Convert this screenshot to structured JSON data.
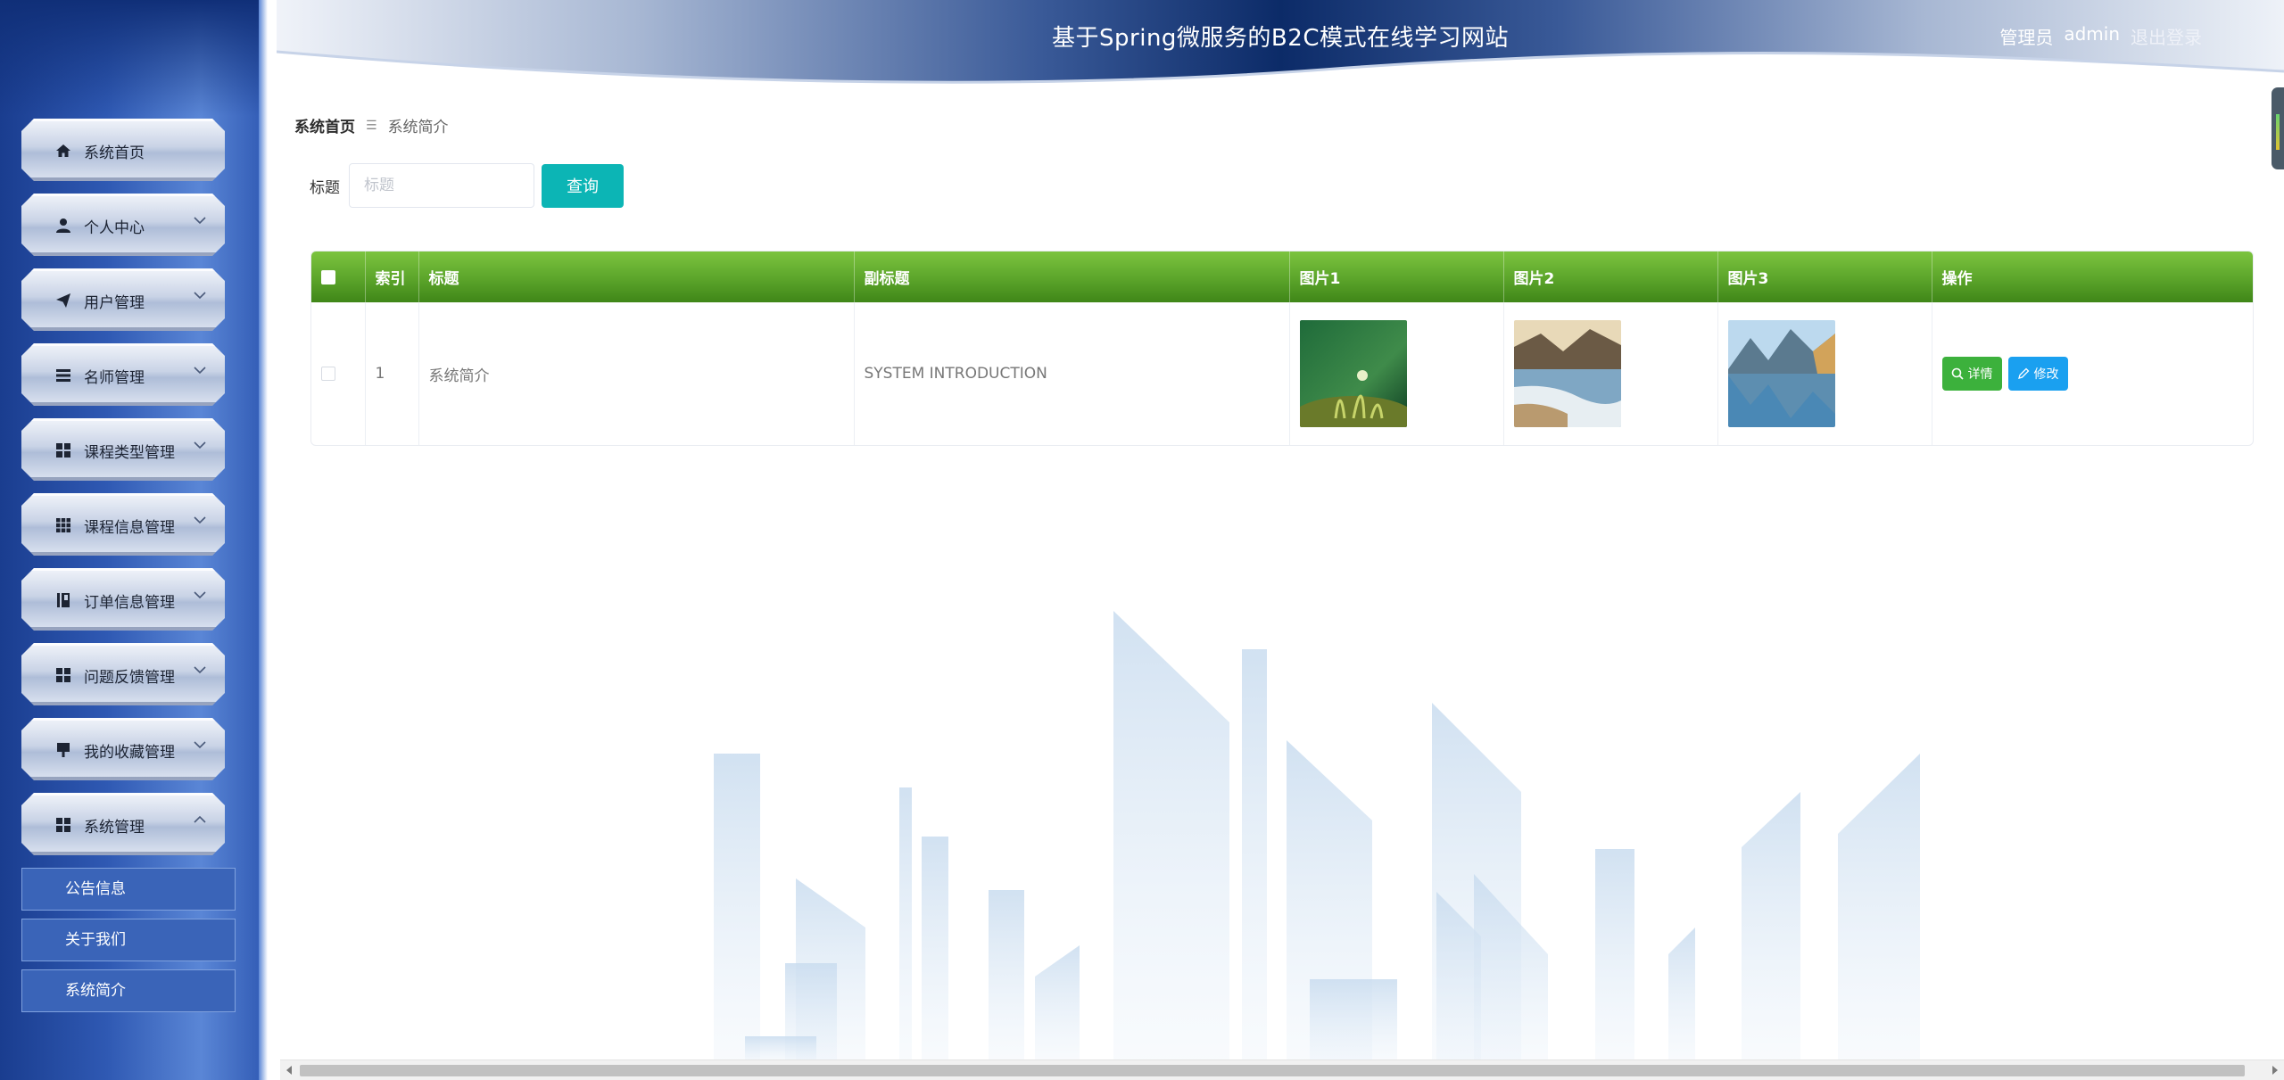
{
  "header": {
    "title": "基于Spring微服务的B2C模式在线学习网站",
    "role": "管理员",
    "username": "admin",
    "logout": "退出登录"
  },
  "sidebar": {
    "items": [
      {
        "label": "系统首页",
        "icon": "home-icon",
        "chevron": "none"
      },
      {
        "label": "个人中心",
        "icon": "user-icon",
        "chevron": "down"
      },
      {
        "label": "用户管理",
        "icon": "paper-plane-icon",
        "chevron": "down"
      },
      {
        "label": "名师管理",
        "icon": "list-icon",
        "chevron": "down"
      },
      {
        "label": "课程类型管理",
        "icon": "grid-icon",
        "chevron": "down"
      },
      {
        "label": "课程信息管理",
        "icon": "grid9-icon",
        "chevron": "down"
      },
      {
        "label": "订单信息管理",
        "icon": "book-icon",
        "chevron": "down"
      },
      {
        "label": "问题反馈管理",
        "icon": "grid-icon",
        "chevron": "down"
      },
      {
        "label": "我的收藏管理",
        "icon": "pin-icon",
        "chevron": "down"
      },
      {
        "label": "系统管理",
        "icon": "grid-icon",
        "chevron": "up"
      }
    ],
    "submenu": [
      {
        "label": "公告信息"
      },
      {
        "label": "关于我们"
      },
      {
        "label": "系统简介"
      }
    ]
  },
  "breadcrumb": {
    "home": "系统首页",
    "separator": "☰",
    "current": "系统简介"
  },
  "search": {
    "label": "标题",
    "placeholder": "标题",
    "value": "",
    "button": "查询"
  },
  "table": {
    "headers": [
      "索引",
      "标题",
      "副标题",
      "图片1",
      "图片2",
      "图片3",
      "操作"
    ],
    "rows": [
      {
        "index": "1",
        "title": "系统简介",
        "subtitle": "SYSTEM INTRODUCTION",
        "images": [
          "green-plant-image",
          "coastal-beach-image",
          "mountain-lake-image"
        ],
        "actions": {
          "detail": "详情",
          "edit": "修改"
        }
      }
    ]
  },
  "colors": {
    "sidebar": "#2f59b3",
    "header_dark": "#0c2b68",
    "table_header": "#5ba42a",
    "search_button": "#0cb5b5",
    "detail_button": "#3cb13c",
    "edit_button": "#1aa0f0"
  }
}
